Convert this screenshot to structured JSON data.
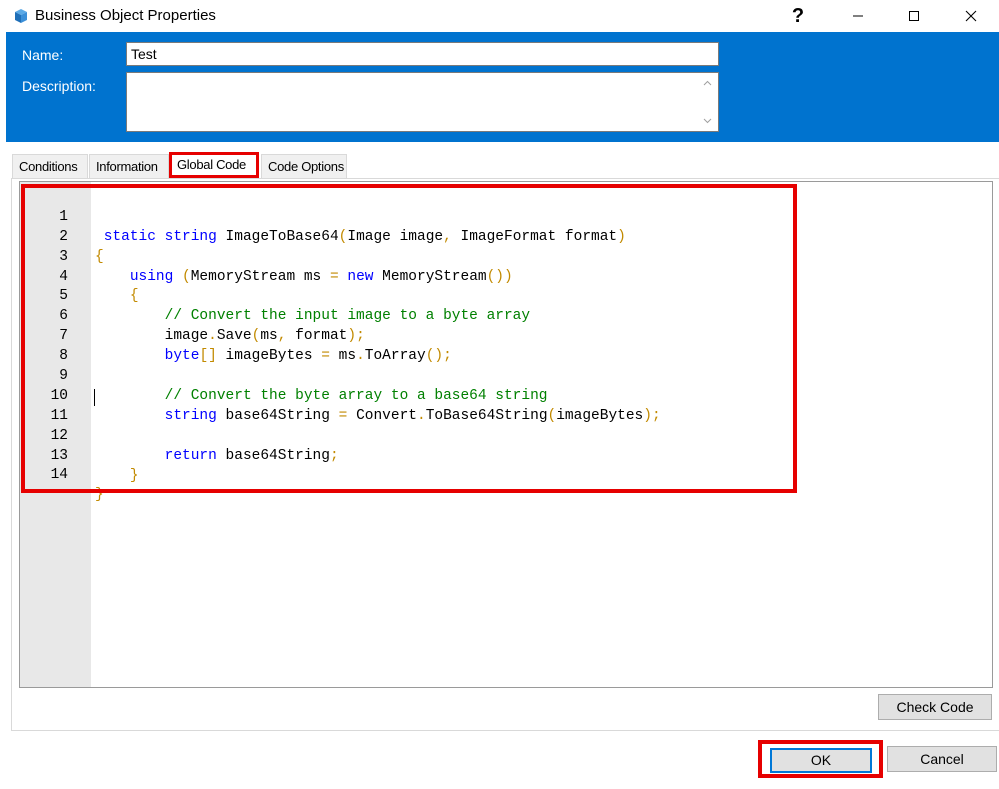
{
  "window": {
    "title": "Business Object Properties",
    "help_label": "?",
    "minimize_label": "—",
    "maximize_label": "☐",
    "close_label": "✕"
  },
  "header": {
    "name_label": "Name:",
    "name_value": "Test",
    "description_label": "Description:",
    "description_value": "",
    "accent_color": "#0073cf"
  },
  "tabs": [
    {
      "label": "Conditions",
      "active": false
    },
    {
      "label": "Information",
      "active": false
    },
    {
      "label": "Global Code",
      "active": true
    },
    {
      "label": "Code Options",
      "active": false
    }
  ],
  "editor": {
    "lines": [
      {
        "n": "1",
        "code": " static string ImageToBase64(Image image, ImageFormat format)"
      },
      {
        "n": "2",
        "code": "{"
      },
      {
        "n": "3",
        "code": "    using (MemoryStream ms = new MemoryStream())"
      },
      {
        "n": "4",
        "code": "    {"
      },
      {
        "n": "5",
        "code": "        // Convert the input image to a byte array"
      },
      {
        "n": "6",
        "code": "        image.Save(ms, format);"
      },
      {
        "n": "7",
        "code": "        byte[] imageBytes = ms.ToArray();"
      },
      {
        "n": "8",
        "code": ""
      },
      {
        "n": "9",
        "code": "        // Convert the byte array to a base64 string"
      },
      {
        "n": "10",
        "code": "        string base64String = Convert.ToBase64String(imageBytes);"
      },
      {
        "n": "11",
        "code": ""
      },
      {
        "n": "12",
        "code": "        return base64String;"
      },
      {
        "n": "13",
        "code": "    }"
      },
      {
        "n": "14",
        "code": "}"
      }
    ],
    "keyword_color": "#0000ff",
    "comment_color": "#008000",
    "punctuation_color": "#c28a00"
  },
  "buttons": {
    "check_code": "Check Code",
    "ok": "OK",
    "cancel": "Cancel"
  },
  "highlight_color": "#e60000"
}
